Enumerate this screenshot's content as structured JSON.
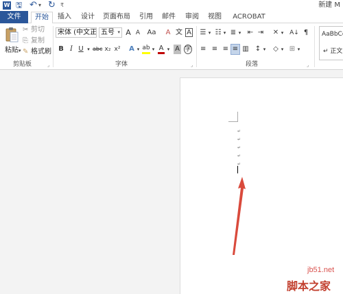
{
  "app": {
    "logo_letter": "W",
    "document_title": "新建 M",
    "quick_access": {
      "save_glyph": "🖫",
      "undo_glyph": "↶",
      "undo_dropdown": "▾",
      "redo_glyph": "↻",
      "customize_glyph": "₹"
    }
  },
  "tabs": {
    "file": "文件",
    "items": [
      "开始",
      "插入",
      "设计",
      "页面布局",
      "引用",
      "邮件",
      "审阅",
      "视图",
      "ACROBAT"
    ],
    "active_index": 0
  },
  "clipboard": {
    "paste_label": "粘贴",
    "paste_dropdown": "▾",
    "cut_label": "剪切",
    "copy_label": "复制",
    "format_painter_label": "格式刷",
    "group_label": "剪贴板",
    "launcher": "⌟"
  },
  "font": {
    "font_name": "宋体 (中文正文",
    "font_size": "五号",
    "grow_glyph": "A",
    "shrink_glyph": "A",
    "change_case": "Aa",
    "clear_format_glyph": "A",
    "phonetic_glyph": "文",
    "border_glyph": "A",
    "bold": "B",
    "italic": "I",
    "underline": "U",
    "strike": "abc",
    "subscript": "x₂",
    "superscript": "x²",
    "text_effect": "A",
    "highlight": "ab",
    "font_color": "A",
    "char_shade": "A",
    "enclose": "字",
    "group_label": "字体",
    "launcher": "⌟"
  },
  "paragraph": {
    "bullets": "☰",
    "numbering": "☷",
    "multilevel": "≣",
    "decrease_indent": "⇤",
    "increase_indent": "⇥",
    "cjk": "✕",
    "sort": "A↓",
    "show_marks": "¶",
    "align_left": "≡",
    "center": "≡",
    "align_right": "≡",
    "justify": "≡",
    "distributed": "▥",
    "line_spacing": "↕",
    "shading": "◇",
    "borders": "⊞",
    "group_label": "段落",
    "launcher": "⌟"
  },
  "styles": {
    "sample": "AaBbCc",
    "name": "正文",
    "prefix_glyph": "↵"
  },
  "document": {
    "paragraph_mark": "↵",
    "empty_paragraph_count": 5
  },
  "watermark": {
    "site": "jb51.net",
    "name": "脚本之家"
  },
  "colors": {
    "accent": "#2b579a",
    "highlight": "#ffff00",
    "font_color": "#c00000",
    "arrow": "#d94a3c"
  }
}
